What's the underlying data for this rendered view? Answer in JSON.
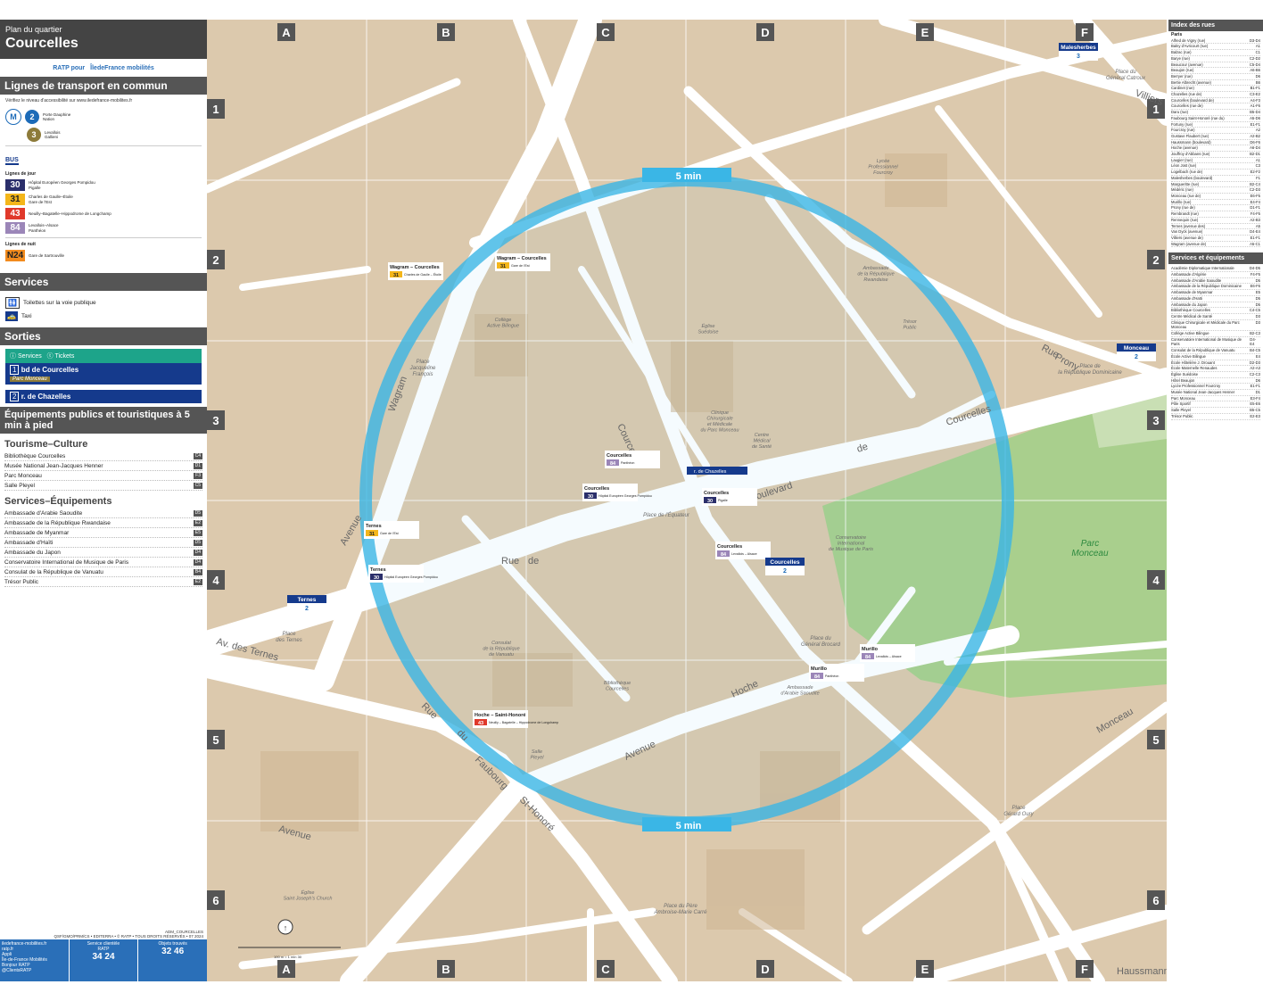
{
  "header": {
    "subtitle": "Plan du quartier",
    "title": "Courcelles"
  },
  "logos": {
    "ratp": "RATP pour",
    "idfm": "ÎledeFrance mobilités"
  },
  "transport": {
    "title": "Lignes de transport en commun",
    "access": "Vérifiez le niveau d'accessibilité sur www.iledefrance-mobilites.fr",
    "metro": [
      {
        "line": "2",
        "dest": "Porte Dauphine\nNation",
        "color": "#1c6bb8"
      },
      {
        "line": "3",
        "dest": "Levallois\nGallieni",
        "color": "#8d7b3a"
      }
    ],
    "bus_label": "BUS",
    "day_label": "Lignes de jour",
    "bus": [
      {
        "line": "30",
        "color": "#2b2f6b",
        "dest": "Hôpital Européen Georges Pompidou\nPigalle"
      },
      {
        "line": "31",
        "color": "#f4b61a",
        "dest": "Charles de Gaulle–Étoile\nGare de l'Est"
      },
      {
        "line": "43",
        "color": "#e0392b",
        "dest": "Neuilly–Bagatelle–Hippodrome de Longchamp"
      },
      {
        "line": "84",
        "color": "#9b86b8",
        "dest": "Levallois–Alsace\nPanthéon"
      }
    ],
    "night_label": "Lignes de nuit",
    "night": [
      {
        "line": "N24",
        "color": "#f28b1e",
        "dest": "Gare de Sartrouville"
      }
    ]
  },
  "services": {
    "title": "Services",
    "items": [
      "Toilettes sur la voie publique",
      "Taxi"
    ]
  },
  "sorties": {
    "title": "Sorties",
    "legend_services": "Services",
    "legend_tickets": "Tickets",
    "exit1": "bd de Courcelles",
    "exit1_sub": "Parc Monceau",
    "exit2": "r. de Chazelles",
    "n1": "1",
    "n2": "2"
  },
  "equip": {
    "title": "Équipements publics et touristiques à 5 min à pied",
    "cat1": "Tourisme–Culture",
    "list1": [
      {
        "name": "Bibliothèque Courcelles",
        "ref": "C4"
      },
      {
        "name": "Musée National Jean-Jacques Henner",
        "ref": "D1"
      },
      {
        "name": "Parc Monceau",
        "ref": "F3"
      },
      {
        "name": "Salle Pleyel",
        "ref": "C5"
      }
    ],
    "cat2": "Services–Équipements",
    "list2": [
      {
        "name": "Ambassade d'Arabie Saoudite",
        "ref": "D5"
      },
      {
        "name": "Ambassade de la République Rwandaise",
        "ref": "E2"
      },
      {
        "name": "Ambassade de Myanmar",
        "ref": "E5"
      },
      {
        "name": "Ambassade d'Haïti",
        "ref": "D5"
      },
      {
        "name": "Ambassade du Japon",
        "ref": "D4"
      },
      {
        "name": "Conservatoire International de Musique de Paris",
        "ref": "D4"
      },
      {
        "name": "Consulat de la République de Vanuatu",
        "ref": "B4"
      },
      {
        "name": "Trésor Public",
        "ref": "E2"
      }
    ]
  },
  "credits": {
    "ref": "ADM_COURCELLES",
    "line2": "QSF/GMO/PRM/CS • EDITERRA • © RATP • TOUS DROITS RÉSERVÉS • 07 2024"
  },
  "footer": {
    "web": "iledefrance-mobilites.fr\nratp.fr",
    "app": "Appli\nÎle-de-France Mobilités\nBonjour RATP",
    "x": "@ClientsRATP",
    "svc": "Service clientèle\nRATP",
    "svc_num": "34 24",
    "lost": "Objets trouvés",
    "lost_num": "32 46"
  },
  "map": {
    "cols": [
      "A",
      "B",
      "C",
      "D",
      "E",
      "F"
    ],
    "rows": [
      "1",
      "2",
      "3",
      "4",
      "5",
      "6"
    ],
    "walk_label": "5 min",
    "streets": [
      {
        "t": "Boulevard",
        "a": -18
      },
      {
        "t": "de",
        "a": -18
      },
      {
        "t": "Courcelles",
        "a": -18
      },
      {
        "t": "Avenue",
        "a": -60
      },
      {
        "t": "Wagram",
        "a": -70
      },
      {
        "t": "Rue",
        "a": 0
      },
      {
        "t": "de",
        "a": 0
      },
      {
        "t": "Courcelles",
        "a": 65
      },
      {
        "t": "Avenue",
        "a": -25
      },
      {
        "t": "Hoche",
        "a": -25
      },
      {
        "t": "Rue",
        "a": 45
      },
      {
        "t": "du",
        "a": 45
      },
      {
        "t": "Faubourg",
        "a": 45
      },
      {
        "t": "St-Honoré",
        "a": 45
      },
      {
        "t": "Av. des Ternes",
        "a": 15
      },
      {
        "t": "Avenue",
        "a": 15
      },
      {
        "t": "Haussmann",
        "a": 0
      },
      {
        "t": "Rue",
        "a": 28
      },
      {
        "t": "Prony",
        "a": 28
      },
      {
        "t": "Monceau",
        "a": -30
      },
      {
        "t": "Villiers",
        "a": 20
      }
    ],
    "places": [
      "Parc\nMonceau",
      "Place de\nla République Dominicaine",
      "Place de l'Équateur",
      "Place\nJacqueline\nFrançois",
      "Place\ndes Ternes",
      "Place du\nGénéral Brocard",
      "Place du Père\nAmbroise-Marie Carré",
      "Place du\nGénéral Catroux",
      "Place\nGérard Oury"
    ],
    "pois": [
      "Collège\nActive Bilingue",
      "Centre\nMédical\nde Santé",
      "Consulat\nde la République\nde Vanuatu",
      "Bibliothèque\nCourcelles",
      "Salle\nPleyel",
      "Conservatoire\nInternational\nde Musique de Paris",
      "Ambassade\nd'Arabie Saoudite",
      "Trésor\nPublic",
      "Église\nSuédoise",
      "Clinique\nChirurgicale\net Médicale\ndu Parc Monceau",
      "Ambassade\nde la République\nRwandaise",
      "Lycée\nProfessionnel\nFourcroy",
      "Église\nSaint Joseph's Church"
    ],
    "stops": [
      {
        "name": "Wagram – Courcelles",
        "line": "31",
        "dest": "Charles de Gaulle – Étoile"
      },
      {
        "name": "Wagram – Courcelles",
        "line": "31",
        "dest": "Gare de l'Est"
      },
      {
        "name": "Courcelles",
        "line": "84",
        "dest": "Panthéon"
      },
      {
        "name": "Courcelles",
        "line": "30",
        "dest": "Hôpital Européen Georges Pompidou"
      },
      {
        "name": "Courcelles",
        "line": "30",
        "dest": "Pigalle"
      },
      {
        "name": "Courcelles",
        "line": "84",
        "dest": "Levallois – Alsace"
      },
      {
        "name": "Ternes",
        "line": "31",
        "dest": "Gare de l'Est"
      },
      {
        "name": "Ternes",
        "line": "30",
        "dest": "Hôpital Européen Georges Pompidou"
      },
      {
        "name": "Hoche – Saint-Honoré",
        "line": "43",
        "dest": "Neuilly – Bagatelle – Hippodrome de Longchamp"
      },
      {
        "name": "Murillo",
        "line": "84",
        "dest": "Levallois – Alsace"
      },
      {
        "name": "Murillo",
        "line": "84",
        "dest": "Panthéon"
      }
    ],
    "stations": [
      {
        "name": "Courcelles",
        "lines": "2"
      },
      {
        "name": "Ternes",
        "lines": "2"
      },
      {
        "name": "Monceau",
        "lines": "2"
      },
      {
        "name": "Malesherbes",
        "lines": "3"
      }
    ],
    "exit_sign": "r. de Chazelles",
    "scale": "100 m = 1 min 30"
  },
  "index": {
    "title": "Index des rues",
    "city": "Paris",
    "streets": [
      [
        "Alfred de Vigny (rue)",
        "D3-D4"
      ],
      [
        "Balny d'Avricourt (rue)",
        "A1"
      ],
      [
        "Balzac (rue)",
        "C1"
      ],
      [
        "Barye (rue)",
        "C2-D2"
      ],
      [
        "Beaucour (avenue)",
        "C5-D4"
      ],
      [
        "Beaujon (rue)",
        "A6-B6"
      ],
      [
        "Berryer (rue)",
        "D6"
      ],
      [
        "Bertie Albrecht (avenue)",
        "B6"
      ],
      [
        "Cardinet (rue)",
        "B1-F1"
      ],
      [
        "Chazelles (rue de)",
        "C3-E2"
      ],
      [
        "Courcelles (boulevard de)",
        "A4-F3"
      ],
      [
        "Courcelles (rue de)",
        "A1-F6"
      ],
      [
        "Daru (rue)",
        "B5-D4"
      ],
      [
        "Faubourg Saint-Honoré (rue du)",
        "A5-D6"
      ],
      [
        "Fortuny (rue)",
        "E1-F1"
      ],
      [
        "Fourcroy (rue)",
        "A2"
      ],
      [
        "Gustave Flaubert (rue)",
        "A2-B2"
      ],
      [
        "Haussmann (boulevard)",
        "D6-F6"
      ],
      [
        "Hoche (avenue)",
        "A6-D4"
      ],
      [
        "Jouffroy d'Abbans (rue)",
        "B2-D1"
      ],
      [
        "Laugier (rue)",
        "A1"
      ],
      [
        "Léon Jost (rue)",
        "C3"
      ],
      [
        "Logelbach (rue de)",
        "E2-F2"
      ],
      [
        "Malesherbes (boulevard)",
        "F1"
      ],
      [
        "Margueritte (rue)",
        "B2-C4"
      ],
      [
        "Médéric (rue)",
        "C2-D3"
      ],
      [
        "Monceau (rue de)",
        "E6-F5"
      ],
      [
        "Murillo (rue)",
        "E4-F4"
      ],
      [
        "Prony (rue de)",
        "D1-F1"
      ],
      [
        "Rembrandt (rue)",
        "F4-F5"
      ],
      [
        "Rennequin (rue)",
        "A2-B3"
      ],
      [
        "Ternes (avenue des)",
        "A5"
      ],
      [
        "Van Dyck (avenue)",
        "D4-E4"
      ],
      [
        "Villiers (avenue de)",
        "E1-F1"
      ],
      [
        "Wagram (avenue de)",
        "A5-C1"
      ]
    ],
    "svc_title": "Services et équipements",
    "svc": [
      [
        "Académie Diplomatique Internationale",
        "D4-D5"
      ],
      [
        "Ambassade d'Algérie",
        "F4-F5"
      ],
      [
        "Ambassade d'Arabie Saoudite",
        "D5"
      ],
      [
        "Ambassade de la République Dominicaine",
        "E6-F6"
      ],
      [
        "Ambassade de Myanmar",
        "E5"
      ],
      [
        "Ambassade d'Haïti",
        "D5"
      ],
      [
        "Ambassade du Japon",
        "D5"
      ],
      [
        "Bibliothèque Courcelles",
        "C4-C5"
      ],
      [
        "Centre Médical de Santé",
        "D3"
      ],
      [
        "Clinique Chirurgicale et Médicale du Parc Monceau",
        "D3"
      ],
      [
        "Collège Active Bilingue",
        "B2-C3"
      ],
      [
        "Conservatoire International de Musique de Paris",
        "D4-E4"
      ],
      [
        "Consulat de la République de Vanuatu",
        "B4-C5"
      ],
      [
        "École Active Bilingue",
        "E4"
      ],
      [
        "École Hôtelière J. Drouant",
        "D2-D3"
      ],
      [
        "École Maternelle Renaudes",
        "A2-A3"
      ],
      [
        "Église Suédoise",
        "C2-C3"
      ],
      [
        "Hôtel Beaujon",
        "D6"
      ],
      [
        "Lycée Professionnel Fourcroy",
        "E1-F1"
      ],
      [
        "Musée National Jean-Jacques Henner",
        "D1"
      ],
      [
        "Parc Monceau",
        "E3-F4"
      ],
      [
        "Pôle Sportif",
        "E5-E6"
      ],
      [
        "Salle Pleyel",
        "B5-C5"
      ],
      [
        "Trésor Public",
        "E2-E3"
      ]
    ]
  },
  "colors": {
    "left_band": "#555555",
    "map_bg": "#dcc9ad",
    "walk_circle": "#3ab6e6",
    "park": "#a9cf8d",
    "metro": "#1c6bb8"
  }
}
